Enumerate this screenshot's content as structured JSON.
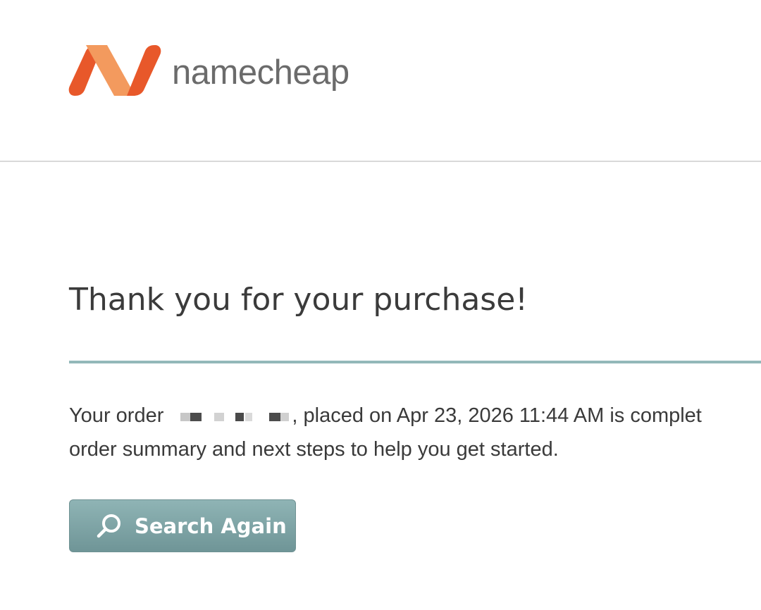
{
  "brand": {
    "name": "namecheap",
    "colors": {
      "orange_dark": "#e8582a",
      "orange_light": "#f0955a"
    }
  },
  "confirmation": {
    "title": "Thank you for your purchase!",
    "order_prefix": "Your order",
    "order_suffix": ", placed on Apr 23, 2026 11:44 AM is complet",
    "line2": "order summary and next steps to help you get started."
  },
  "actions": {
    "search_again_label": "Search Again",
    "search_icon": "search-icon"
  },
  "colors": {
    "rule": "#93b8b9",
    "button": "#7fa5a6"
  }
}
